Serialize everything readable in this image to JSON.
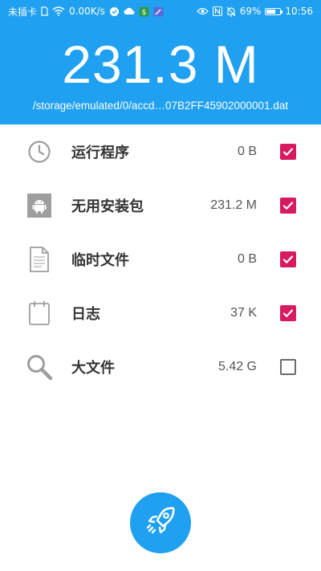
{
  "status_bar": {
    "carrier": "未插卡",
    "speed": "0.00K/s",
    "battery_percent_text": "69%",
    "battery_level": 0.69,
    "time": "10:56"
  },
  "header": {
    "total_size": "231.3 M",
    "current_path": "/storage/emulated/0/accd…07B2FF45902000001.dat"
  },
  "items": [
    {
      "label": "运行程序",
      "size": "0 B",
      "checked": true,
      "icon": "clock-icon"
    },
    {
      "label": "无用安装包",
      "size": "231.2 M",
      "checked": true,
      "icon": "android-icon"
    },
    {
      "label": "临时文件",
      "size": "0 B",
      "checked": true,
      "icon": "document-icon"
    },
    {
      "label": "日志",
      "size": "37 K",
      "checked": true,
      "icon": "calendar-icon"
    },
    {
      "label": "大文件",
      "size": "5.42 G",
      "checked": false,
      "icon": "search-icon"
    }
  ],
  "colors": {
    "primary": "#1fa0f0",
    "checkbox_checked": "#d81b60",
    "icon_gray": "#9e9e9e"
  },
  "fab": {
    "icon": "rocket-icon"
  }
}
